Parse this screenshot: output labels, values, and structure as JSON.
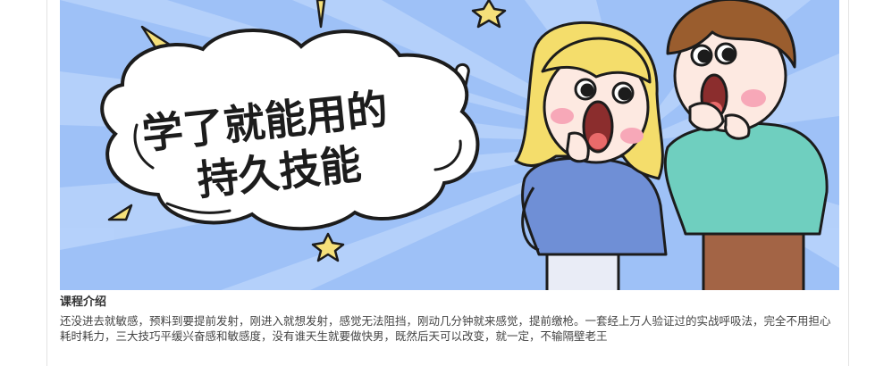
{
  "banner": {
    "headline_line1": "学了就能用的",
    "headline_line2": "持久技能"
  },
  "intro": {
    "title": "课程介绍",
    "description": "还没进去就敏感，预料到要提前发射，刚进入就想发射，感觉无法阻挡，刚动几分钟就来感觉，提前缴枪。一套经上万人验证过的实战呼吸法，完全不用担心耗时耗力，三大技巧平缓兴奋感和敏感度，没有谁天生就要做快男，既然后天可以改变，就一定，不输隔壁老王"
  },
  "colors": {
    "banner_bg": "#9ec1f7",
    "ray": "#b9d3fb",
    "bubble": "#ffffff",
    "outline": "#1c1c1c",
    "star": "#f5e07a",
    "girl_hair": "#f4dd6b",
    "girl_shirt": "#6f8fd6",
    "boy_hair": "#9a5d2e",
    "boy_shirt": "#6fcfbf",
    "skin": "#fde9e1",
    "blush": "#f7a8b8"
  }
}
